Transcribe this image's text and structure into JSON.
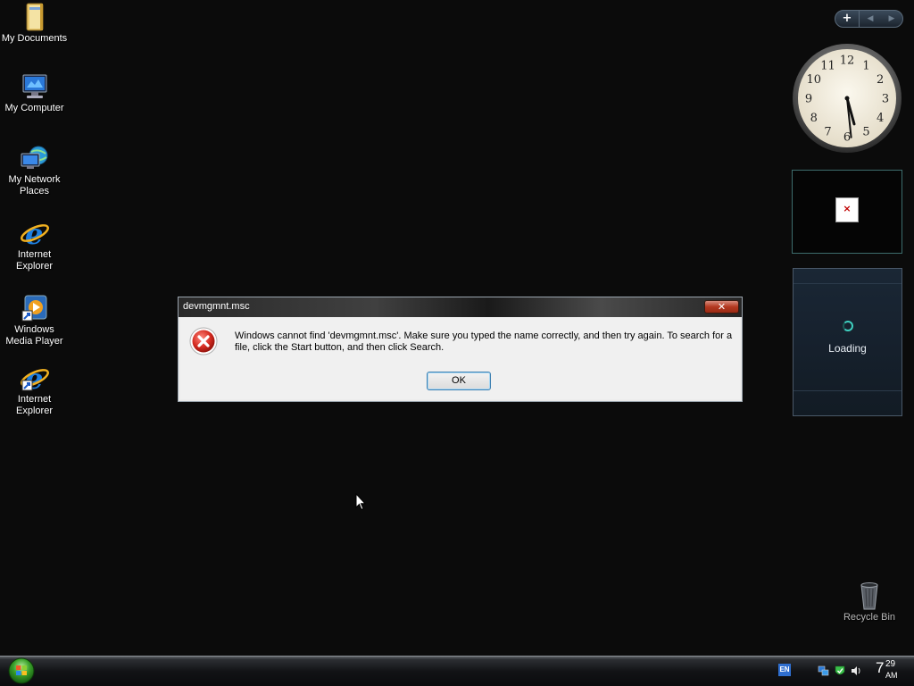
{
  "desktop": {
    "icons": [
      {
        "label": "My Documents",
        "icon": "folder-documents-icon"
      },
      {
        "label": "My Computer",
        "icon": "computer-icon"
      },
      {
        "label": "My Network Places",
        "icon": "network-places-icon"
      },
      {
        "label": "Internet Explorer",
        "icon": "internet-explorer-icon"
      },
      {
        "label": "Windows Media Player",
        "icon": "media-player-shortcut-icon"
      },
      {
        "label": "Internet Explorer",
        "icon": "internet-explorer-shortcut-icon"
      }
    ],
    "recycle_bin": {
      "label": "Recycle Bin",
      "icon": "recycle-bin-icon"
    }
  },
  "sidebar": {
    "toolbar": {
      "add_label": "+",
      "prev_label": "◀",
      "next_label": "▶"
    },
    "clock_gadget": {
      "time_hour": 5,
      "time_minute": 29
    },
    "picture_gadget": {
      "placeholder_icon": "broken-image-icon",
      "mark": "×"
    },
    "loading_gadget": {
      "text": "Loading"
    }
  },
  "dialog": {
    "title": "devmgmnt.msc",
    "close_label": "✕",
    "message": "Windows cannot find 'devmgmnt.msc'. Make sure you typed the name correctly, and then try again. To search for a file, click the Start button, and then click Search.",
    "ok_label": "OK",
    "icon": "error-icon"
  },
  "taskbar": {
    "language": "EN",
    "tray_icons": [
      "network-icon",
      "security-icon",
      "speaker-icon"
    ],
    "clock": {
      "hour": "7",
      "minute": "29",
      "ampm": "AM"
    }
  },
  "colors": {
    "desktop_bg": "#0b0b0b",
    "accent_teal": "#3fd0c0",
    "error_red": "#c8201a"
  }
}
